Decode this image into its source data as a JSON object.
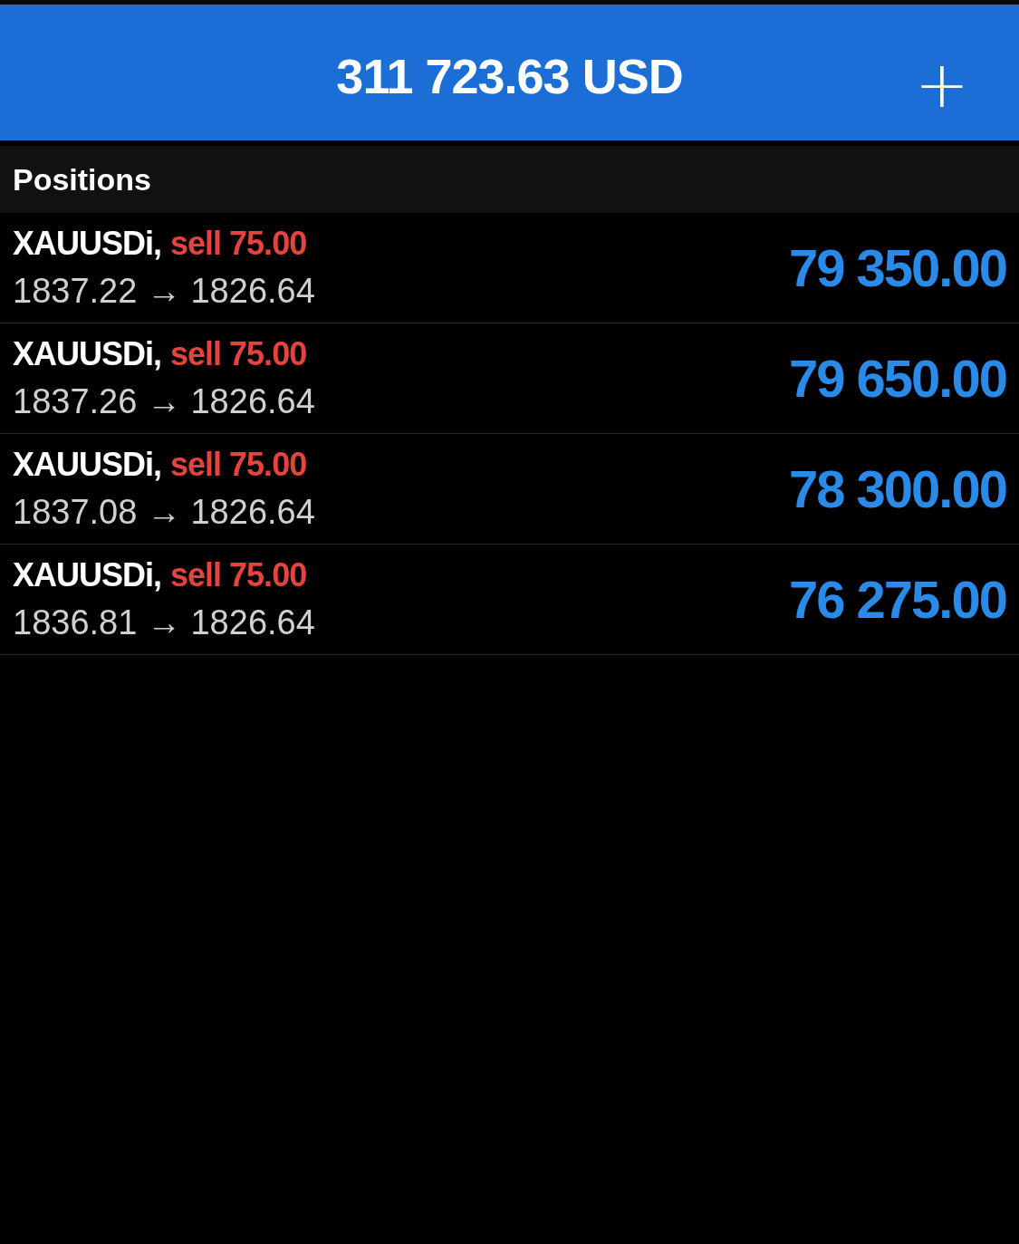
{
  "header": {
    "balance": "311 723.63 USD",
    "add_button": "+"
  },
  "section": {
    "title": "Positions"
  },
  "positions": [
    {
      "symbol": "XAUUSDi,",
      "order": "sell 75.00",
      "prices": "1837.22 → 1826.64",
      "profit": "79 350.00"
    },
    {
      "symbol": "XAUUSDi,",
      "order": "sell 75.00",
      "prices": "1837.26 → 1826.64",
      "profit": "79 650.00"
    },
    {
      "symbol": "XAUUSDi,",
      "order": "sell 75.00",
      "prices": "1837.08 → 1826.64",
      "profit": "78 300.00"
    },
    {
      "symbol": "XAUUSDi,",
      "order": "sell 75.00",
      "prices": "1836.81 → 1826.64",
      "profit": "76 275.00"
    }
  ]
}
